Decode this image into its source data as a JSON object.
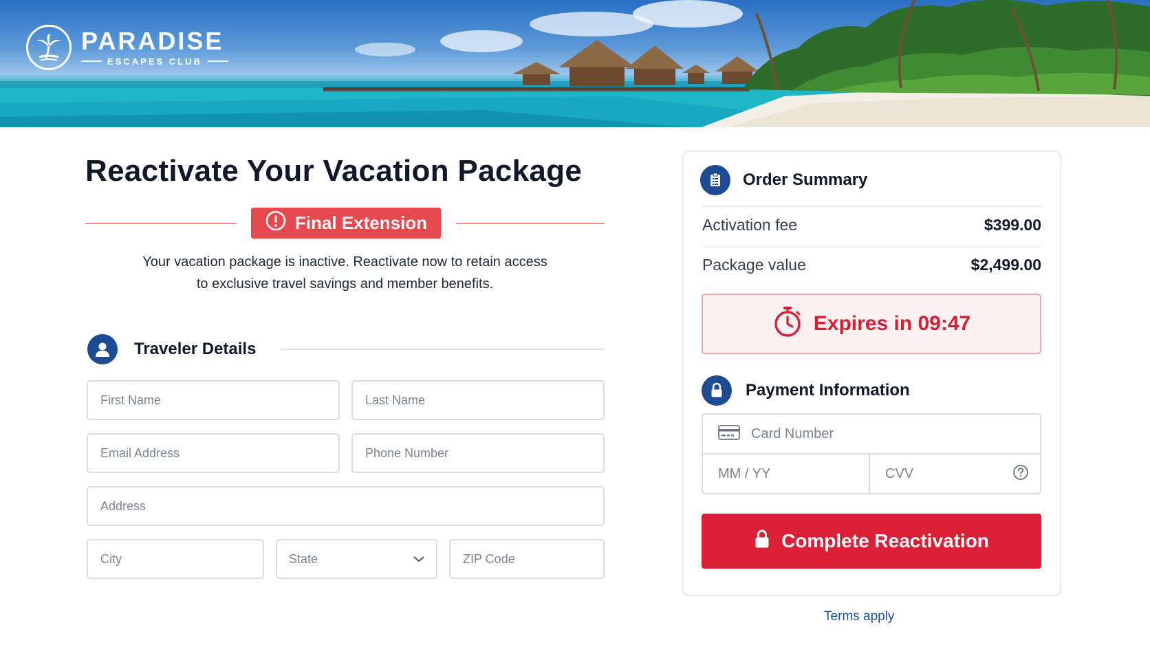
{
  "brand": {
    "name": "PARADISE",
    "tagline": "ESCAPES CLUB"
  },
  "main": {
    "title": "Reactivate Your Vacation Package",
    "alert_label": "Final Extension",
    "intro_line1": "Your vacation package is inactive. Reactivate now to retain access",
    "intro_line2": "to exclusive travel savings and member benefits."
  },
  "traveler": {
    "heading": "Traveler Details",
    "first_name": {
      "placeholder": "First Name",
      "value": ""
    },
    "last_name": {
      "placeholder": "Last Name",
      "value": ""
    },
    "email": {
      "placeholder": "Email Address",
      "value": ""
    },
    "phone": {
      "placeholder": "Phone Number",
      "value": ""
    },
    "address": {
      "placeholder": "Address",
      "value": ""
    },
    "city": {
      "placeholder": "City",
      "value": ""
    },
    "state": {
      "selected": "State"
    },
    "zip": {
      "placeholder": "ZIP Code",
      "value": ""
    }
  },
  "summary": {
    "heading": "Order Summary",
    "rows": [
      {
        "label": "Activation fee",
        "value": "$399.00"
      },
      {
        "label": "Package value",
        "value": "$2,499.00"
      }
    ],
    "timer_text": "Expires in 09:47"
  },
  "payment": {
    "heading": "Payment Information",
    "card_number": {
      "placeholder": "Card Number"
    },
    "expiry": {
      "placeholder": "MM / YY"
    },
    "cvv": {
      "placeholder": "CVV"
    },
    "submit_label": "Complete Reactivation"
  },
  "footer": {
    "terms_label": "Terms apply"
  },
  "colors": {
    "brand_navy": "#1c4a93",
    "alert_red": "#e5484d",
    "cta_red": "#db1f36",
    "link_blue": "#1d4e9a"
  },
  "icons": {
    "logo": "palm-tree-icon",
    "alert": "exclamation-circle-icon",
    "traveler": "user-icon",
    "summary": "clipboard-list-icon",
    "timer": "stopwatch-icon",
    "payment": "lock-icon",
    "card": "credit-card-icon",
    "cvv_help": "question-circle-icon",
    "state_select": "chevron-down-icon"
  }
}
